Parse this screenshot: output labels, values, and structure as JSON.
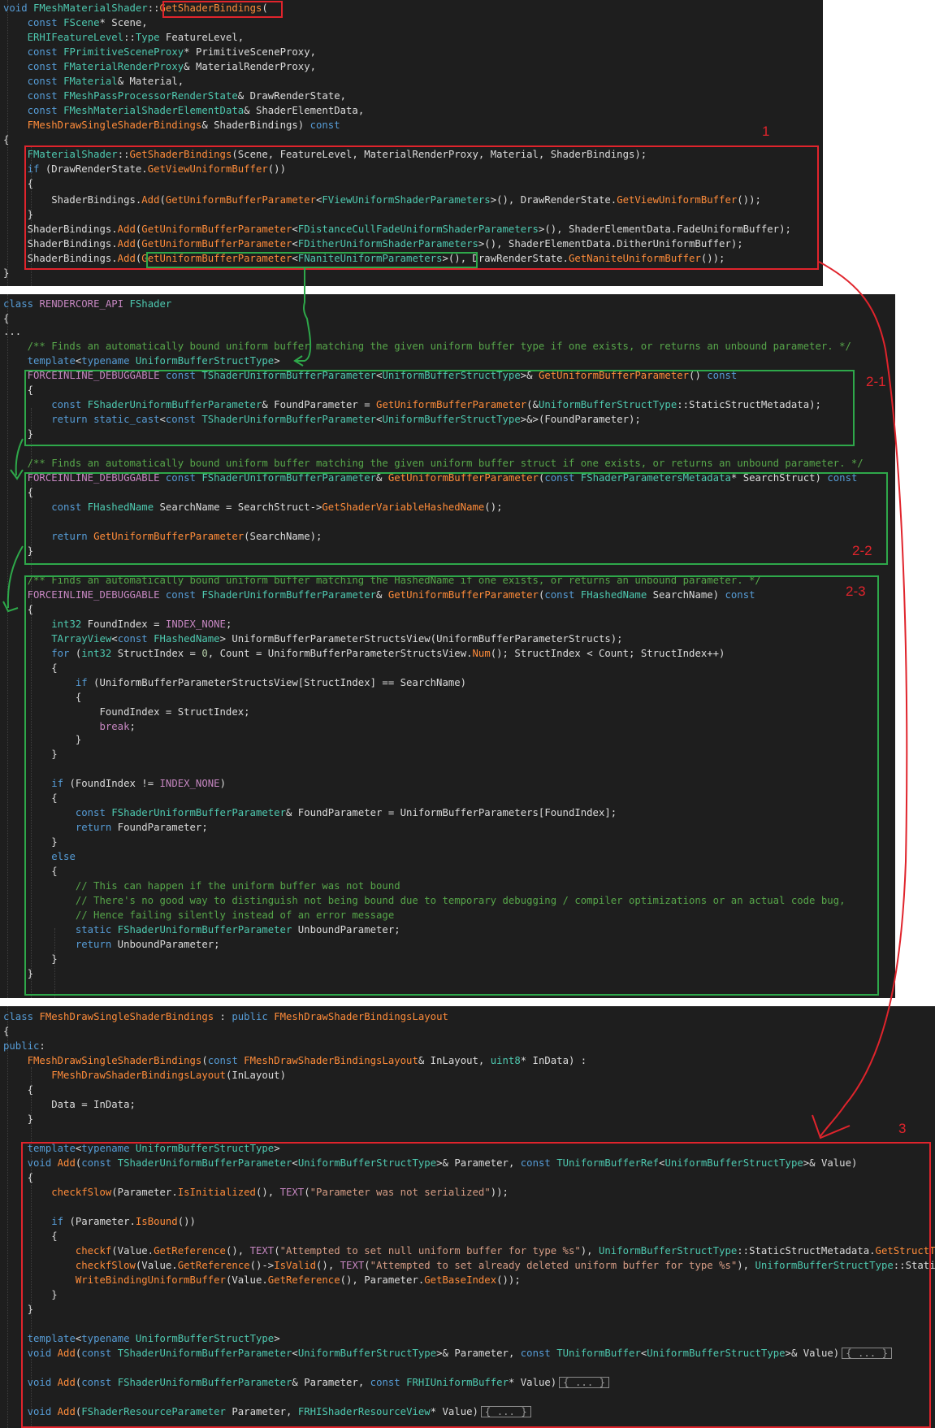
{
  "panel1": {
    "lines": [
      "void FMeshMaterialShader::GetShaderBindings(",
      "    const FScene* Scene,",
      "    ERHIFeatureLevel::Type FeatureLevel,",
      "    const FPrimitiveSceneProxy* PrimitiveSceneProxy,",
      "    const FMaterialRenderProxy& MaterialRenderProxy,",
      "    const FMaterial& Material,",
      "    const FMeshPassProcessorRenderState& DrawRenderState,",
      "    const FMeshMaterialShaderElementData& ShaderElementData,",
      "    FMeshDrawSingleShaderBindings& ShaderBindings) const",
      "{",
      "    FMaterialShader::GetShaderBindings(Scene, FeatureLevel, MaterialRenderProxy, Material, ShaderBindings);",
      "    if (DrawRenderState.GetViewUniformBuffer())",
      "    {",
      "        ShaderBindings.Add(GetUniformBufferParameter<FViewUniformShaderParameters>(), DrawRenderState.GetViewUniformBuffer());",
      "    }",
      "    ShaderBindings.Add(GetUniformBufferParameter<FDistanceCullFadeUniformShaderParameters>(), ShaderElementData.FadeUniformBuffer);",
      "    ShaderBindings.Add(GetUniformBufferParameter<FDitherUniformShaderParameters>(), ShaderElementData.DitherUniformBuffer);",
      "    ShaderBindings.Add(GetUniformBufferParameter<FNaniteUniformParameters>(), DrawRenderState.GetNaniteUniformBuffer());",
      "}"
    ]
  },
  "panel2": {
    "lines": [
      "class RENDERCORE_API FShader",
      "{",
      "...",
      "    /** Finds an automatically bound uniform buffer matching the given uniform buffer type if one exists, or returns an unbound parameter. */",
      "    template<typename UniformBufferStructType>",
      "    FORCEINLINE_DEBUGGABLE const TShaderUniformBufferParameter<UniformBufferStructType>& GetUniformBufferParameter() const",
      "    {",
      "        const FShaderUniformBufferParameter& FoundParameter = GetUniformBufferParameter(&UniformBufferStructType::StaticStructMetadata);",
      "        return static_cast<const TShaderUniformBufferParameter<UniformBufferStructType>&>(FoundParameter);",
      "    }",
      "",
      "    /** Finds an automatically bound uniform buffer matching the given uniform buffer struct if one exists, or returns an unbound parameter. */",
      "    FORCEINLINE_DEBUGGABLE const FShaderUniformBufferParameter& GetUniformBufferParameter(const FShaderParametersMetadata* SearchStruct) const",
      "    {",
      "        const FHashedName SearchName = SearchStruct->GetShaderVariableHashedName();",
      "",
      "        return GetUniformBufferParameter(SearchName);",
      "    }",
      "",
      "    /** Finds an automatically bound uniform buffer matching the HashedName if one exists, or returns an unbound parameter. */",
      "    FORCEINLINE_DEBUGGABLE const FShaderUniformBufferParameter& GetUniformBufferParameter(const FHashedName SearchName) const",
      "    {",
      "        int32 FoundIndex = INDEX_NONE;",
      "        TArrayView<const FHashedName> UniformBufferParameterStructsView(UniformBufferParameterStructs);",
      "        for (int32 StructIndex = 0, Count = UniformBufferParameterStructsView.Num(); StructIndex < Count; StructIndex++)",
      "        {",
      "            if (UniformBufferParameterStructsView[StructIndex] == SearchName)",
      "            {",
      "                FoundIndex = StructIndex;",
      "                break;",
      "            }",
      "        }",
      "",
      "        if (FoundIndex != INDEX_NONE)",
      "        {",
      "            const FShaderUniformBufferParameter& FoundParameter = UniformBufferParameters[FoundIndex];",
      "            return FoundParameter;",
      "        }",
      "        else",
      "        {",
      "            // This can happen if the uniform buffer was not bound",
      "            // There's no good way to distinguish not being bound due to temporary debugging / compiler optimizations or an actual code bug,",
      "            // Hence failing silently instead of an error message",
      "            static FShaderUniformBufferParameter UnboundParameter;",
      "            return UnboundParameter;",
      "        }",
      "    }"
    ]
  },
  "panel3": {
    "lines": [
      "class FMeshDrawSingleShaderBindings : public FMeshDrawShaderBindingsLayout",
      "{",
      "public:",
      "    FMeshDrawSingleShaderBindings(const FMeshDrawShaderBindingsLayout& InLayout, uint8* InData) :",
      "        FMeshDrawShaderBindingsLayout(InLayout)",
      "    {",
      "        Data = InData;",
      "    }",
      "",
      "    template<typename UniformBufferStructType>",
      "    void Add(const TShaderUniformBufferParameter<UniformBufferStructType>& Parameter, const TUniformBufferRef<UniformBufferStructType>& Value)",
      "    {",
      "        checkfSlow(Parameter.IsInitialized(), TEXT(\"Parameter was not serialized\"));",
      "",
      "        if (Parameter.IsBound())",
      "        {",
      "            checkf(Value.GetReference(), TEXT(\"Attempted to set null uniform buffer for type %s\"), UniformBufferStructType::StaticStructMetadata.GetStructTypeName());",
      "            checkfSlow(Value.GetReference()->IsValid(), TEXT(\"Attempted to set already deleted uniform buffer for type %s\"), UniformBufferStructType::StaticStructMetadata.GetStructTypeName());",
      "            WriteBindingUniformBuffer(Value.GetReference(), Parameter.GetBaseIndex());",
      "        }",
      "    }",
      "",
      "    template<typename UniformBufferStructType>",
      "    void Add(const TShaderUniformBufferParameter<UniformBufferStructType>& Parameter, const TUniformBuffer<UniformBufferStructType>& Value)",
      "",
      "    void Add(const FShaderUniformBufferParameter& Parameter, const FRHIUniformBuffer* Value)",
      "",
      "    void Add(FShaderResourceParameter Parameter, FRHIShaderResourceView* Value)"
    ],
    "collapsed_marker": "{ ... }"
  },
  "annotations": {
    "label_1": "1",
    "label_2_1": "2-1",
    "label_2_2": "2-2",
    "label_2_3": "2-3",
    "label_3": "3"
  },
  "colors": {
    "keyword": "#569cd6",
    "type": "#4ec9b0",
    "function": "#ff8c3a",
    "string": "#d69d85",
    "comment": "#57a64a",
    "macro": "#c586c0",
    "number": "#b5cea8",
    "red_box": "#e0242c",
    "green_box": "#2ea84a",
    "editor_bg": "#1e1e1e"
  }
}
